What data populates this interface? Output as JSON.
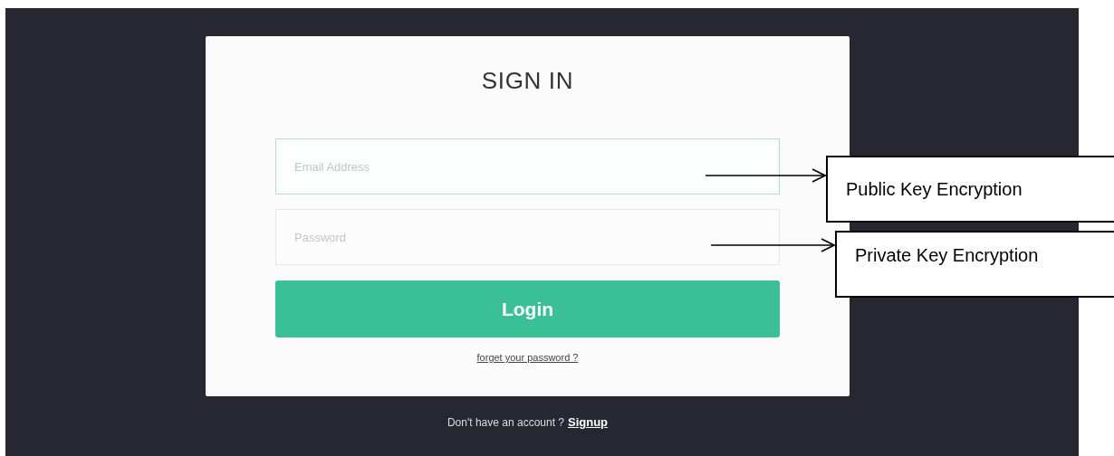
{
  "card": {
    "title": "SIGN IN",
    "fields": [
      {
        "placeholder": "Email Address",
        "focused": true
      },
      {
        "placeholder": "Password",
        "focused": false
      }
    ],
    "button": "Login",
    "forgot_link": "forget your password ?"
  },
  "footer": {
    "text": "Don't have an account ?",
    "link": "Signup"
  },
  "annotations": [
    {
      "text": "Public Key Encryption"
    },
    {
      "text": "Private Key Encryption"
    }
  ]
}
